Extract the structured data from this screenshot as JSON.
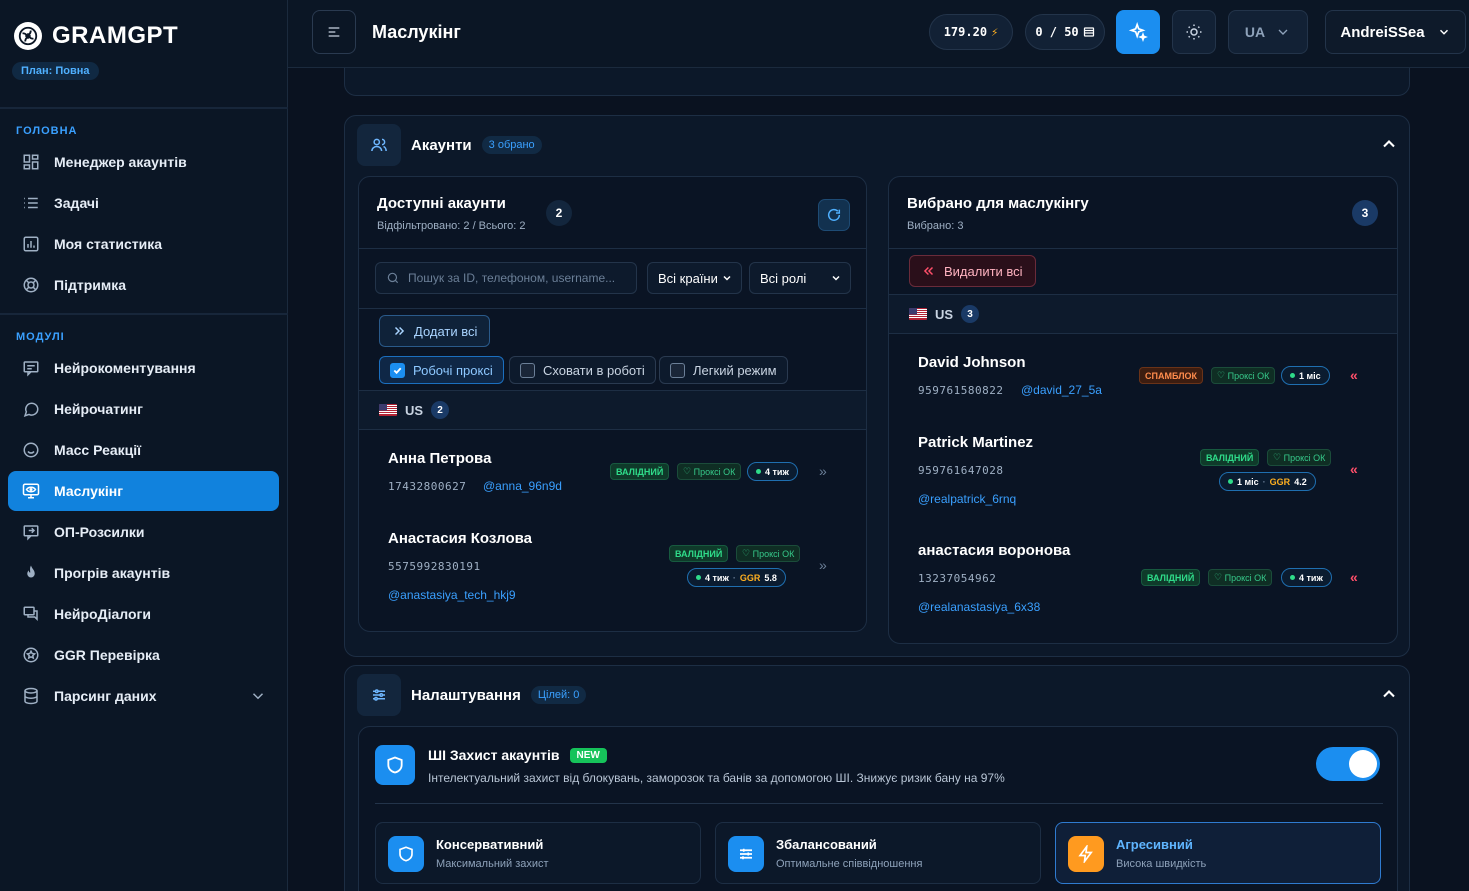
{
  "brand": {
    "name": "GRAMGPT",
    "plan": "План: Повна"
  },
  "sidebar": {
    "section_main": "ГОЛОВНА",
    "section_modules": "МОДУЛІ",
    "main_items": [
      {
        "label": "Менеджер акаунтів",
        "icon": "grid-icon"
      },
      {
        "label": "Задачі",
        "icon": "list-icon"
      },
      {
        "label": "Моя статистика",
        "icon": "chart-icon"
      },
      {
        "label": "Підтримка",
        "icon": "lifebuoy-icon"
      }
    ],
    "module_items": [
      {
        "label": "Нейрокоментування",
        "icon": "comment-icon"
      },
      {
        "label": "Нейрочатинг",
        "icon": "chat-bubble-icon"
      },
      {
        "label": "Масс Реакції",
        "icon": "smile-icon"
      },
      {
        "label": "Маслукінг",
        "icon": "monitor-eye-icon",
        "active": true
      },
      {
        "label": "ОП-Розсилки",
        "icon": "send-icon"
      },
      {
        "label": "Прогрів акаунтів",
        "icon": "flame-icon"
      },
      {
        "label": "НейроДіалоги",
        "icon": "dialog-icon"
      },
      {
        "label": "GGR Перевірка",
        "icon": "badge-check-icon"
      },
      {
        "label": "Парсинг даних",
        "icon": "database-icon"
      }
    ]
  },
  "topbar": {
    "title": "Маслукінг",
    "balance": "179.20",
    "limits": "0 / 50",
    "lang": "UA",
    "user": "AndreiSSea"
  },
  "accounts": {
    "title": "Акаунти",
    "selected_badge": "3 обрано",
    "available": {
      "title": "Доступні акаунти",
      "desc": "Відфільтровано: 2 / Всього: 2",
      "count": "2",
      "search_placeholder": "Пошук за ID, телефоном, username...",
      "country_select": "Всі країни",
      "role_select": "Всі ролі",
      "add_all": "Додати всі",
      "filter_proxy": "Робочі проксі",
      "filter_hide": "Сховати в роботі",
      "filter_light": "Легкий режим",
      "group_country": "US",
      "group_count": "2",
      "items": [
        {
          "name": "Анна Петрова",
          "phone": "17432800627",
          "username": "@anna_96n9d",
          "status": "ВАЛІДНИЙ",
          "proxy": "Проксі ОК",
          "age": "4 тиж"
        },
        {
          "name": "Анастасия Козлова",
          "phone": "5575992830191",
          "username": "@anastasiya_tech_hkj9",
          "status": "ВАЛІДНИЙ",
          "proxy": "Проксі ОК",
          "age": "4 тиж",
          "ggr_label": "GGR",
          "ggr": "5.8"
        }
      ]
    },
    "chosen": {
      "title": "Вибрано для маслукінгу",
      "desc": "Вибрано: 3",
      "count": "3",
      "remove_all": "Видалити всі",
      "group_country": "US",
      "group_count": "3",
      "items": [
        {
          "name": "David Johnson",
          "phone": "959761580822",
          "username": "@david_27_5a",
          "status": "СПАМБЛОК",
          "proxy": "Проксі ОК",
          "age": "1 міс"
        },
        {
          "name": "Patrick Martinez",
          "phone": "959761647028",
          "username": "@realpatrick_6rnq",
          "status": "ВАЛІДНИЙ",
          "proxy": "Проксі ОК",
          "age": "1 міс",
          "ggr_label": "GGR",
          "ggr": "4.2"
        },
        {
          "name": "анастасия воронова",
          "phone": "13237054962",
          "username": "@realanastasiya_6x38",
          "status": "ВАЛІДНИЙ",
          "proxy": "Проксі ОК",
          "age": "4 тиж"
        }
      ]
    }
  },
  "settings": {
    "title": "Налаштування",
    "targets_badge": "Цілей: 0",
    "shield": {
      "title": "ШІ Захист акаунтів",
      "new_badge": "NEW",
      "desc": "Інтелектуальний захист від блокувань, заморозок та банів за допомогою ШІ. Знижує ризик бану на 97%",
      "enabled": true
    },
    "modes": [
      {
        "title": "Консервативний",
        "desc": "Максимальний захист",
        "color": "#1b8ef0"
      },
      {
        "title": "Збалансований",
        "desc": "Оптимальне співвідношення",
        "color": "#1b8ef0"
      },
      {
        "title": "Агресивний",
        "desc": "Висока швидкість",
        "color": "#ff9a1f",
        "selected": true
      }
    ]
  },
  "colors": {
    "accent": "#1b8ef0",
    "valid": "#2fdc8a",
    "spam": "#ff8c4d",
    "danger": "#ff4f6a"
  }
}
